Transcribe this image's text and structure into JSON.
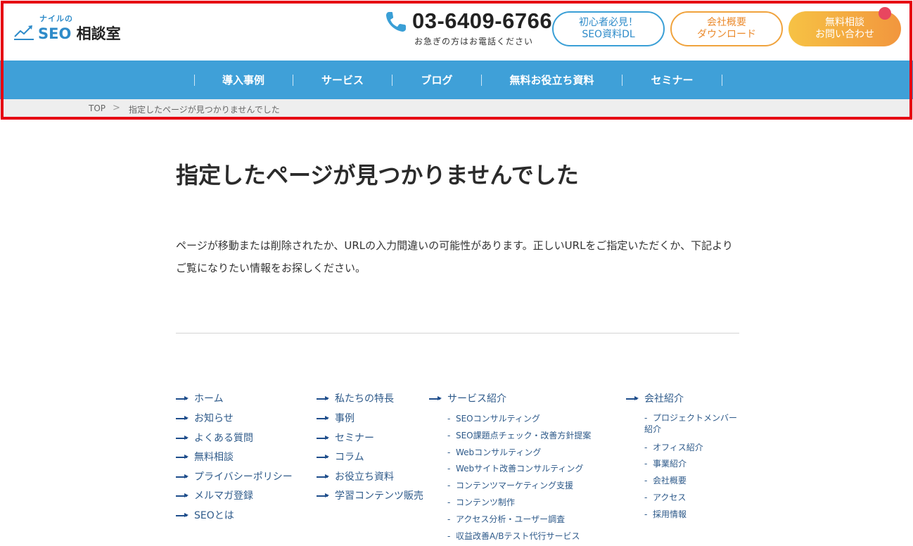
{
  "header": {
    "logo_top": "ナイルの",
    "logo_seo": "SEO",
    "logo_name": "相談室",
    "phone_number": "03-6409-6766",
    "phone_note": "お急ぎの方はお電話ください",
    "btn_dl_line1": "初心者必見！",
    "btn_dl_line2": "SEO資料DL",
    "btn_company_line1": "会社概要",
    "btn_company_line2": "ダウンロード",
    "btn_contact_line1": "無料相談",
    "btn_contact_line2": "お問い合わせ"
  },
  "nav": {
    "items": [
      "導入事例",
      "サービス",
      "ブログ",
      "無料お役立ち資料",
      "セミナー"
    ]
  },
  "breadcrumb": {
    "top": "TOP",
    "separator": ">",
    "current": "指定したページが見つかりませんでした"
  },
  "main": {
    "title": "指定したページが見つかりませんでした",
    "message": "ページが移動または削除されたか、URLの入力間違いの可能性があります。正しいURLをご指定いただくか、下記よりご覧になりたい情報をお探しください。"
  },
  "footer": {
    "col1": [
      "ホーム",
      "お知らせ",
      "よくある質問",
      "無料相談",
      "プライバシーポリシー",
      "メルマガ登録",
      "SEOとは"
    ],
    "col2": [
      "私たちの特長",
      "事例",
      "セミナー",
      "コラム",
      "お役立ち資料",
      "学習コンテンツ販売"
    ],
    "col3_title": "サービス紹介",
    "col3_items": [
      "SEOコンサルティング",
      "SEO課題点チェック・改善方針提案",
      "Webコンサルティング",
      "Webサイト改善コンサルティング",
      "コンテンツマーケティング支援",
      "コンテンツ制作",
      "アクセス分析・ユーザー調査",
      "収益改善A/Bテスト代行サービス"
    ],
    "col4_title": "会社紹介",
    "col4_items": [
      "プロジェクトメンバー紹介",
      "オフィス紹介",
      "事業紹介",
      "会社概要",
      "アクセス",
      "採用情報"
    ],
    "sub_prefix": "-"
  },
  "colors": {
    "brand_blue": "#3fa0d8",
    "accent_orange": "#f2963e",
    "highlight_red": "#e60012"
  }
}
